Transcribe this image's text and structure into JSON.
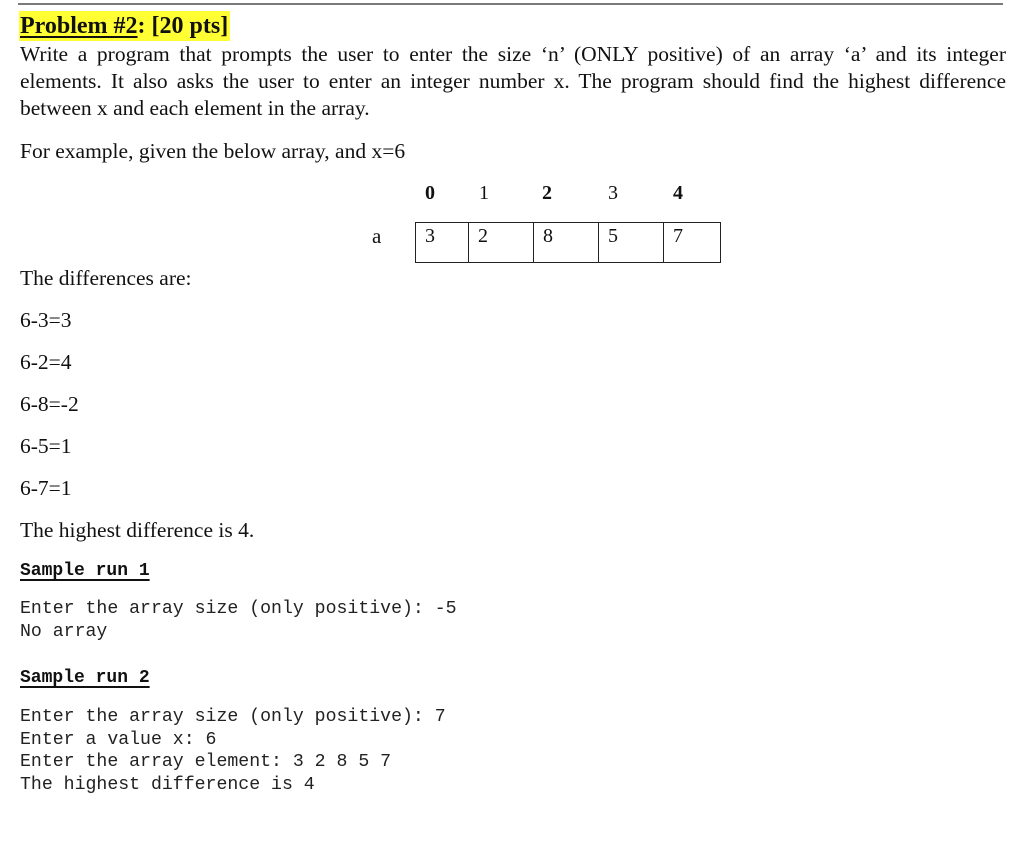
{
  "problem": {
    "title_underlined": "Problem #2",
    "title_rest": ": [20 pts]",
    "highlight_color": "#ffff33",
    "description": "Write a program that prompts the user to enter the size ‘n’ (ONLY positive) of an array ‘a’ and its integer elements. It also asks the user to enter an integer number x. The program should find the highest difference between x and each element in the array."
  },
  "example": {
    "intro": "For example, given the below array, and x=6",
    "array_name": "a",
    "indices": [
      {
        "label": "0",
        "bold": true
      },
      {
        "label": "1",
        "bold": false
      },
      {
        "label": "2",
        "bold": true
      },
      {
        "label": "3",
        "bold": false
      },
      {
        "label": "4",
        "bold": true
      }
    ],
    "values": [
      "3",
      "2",
      "8",
      "5",
      "7"
    ],
    "differences_heading": "The differences are:",
    "differences": [
      "6-3=3",
      "6-2=4",
      "6-8=-2",
      "6-5=1",
      "6-7=1"
    ],
    "conclusion": "The highest difference is 4."
  },
  "sample_runs": [
    {
      "heading": "Sample run 1",
      "lines": [
        "Enter the array size (only positive): -5",
        "No array"
      ]
    },
    {
      "heading": "Sample run 2",
      "lines": [
        "Enter the array size (only positive): 7",
        "Enter a value x: 6",
        "Enter the array element: 3 2 8 5 7",
        "The highest difference is 4"
      ]
    }
  ]
}
